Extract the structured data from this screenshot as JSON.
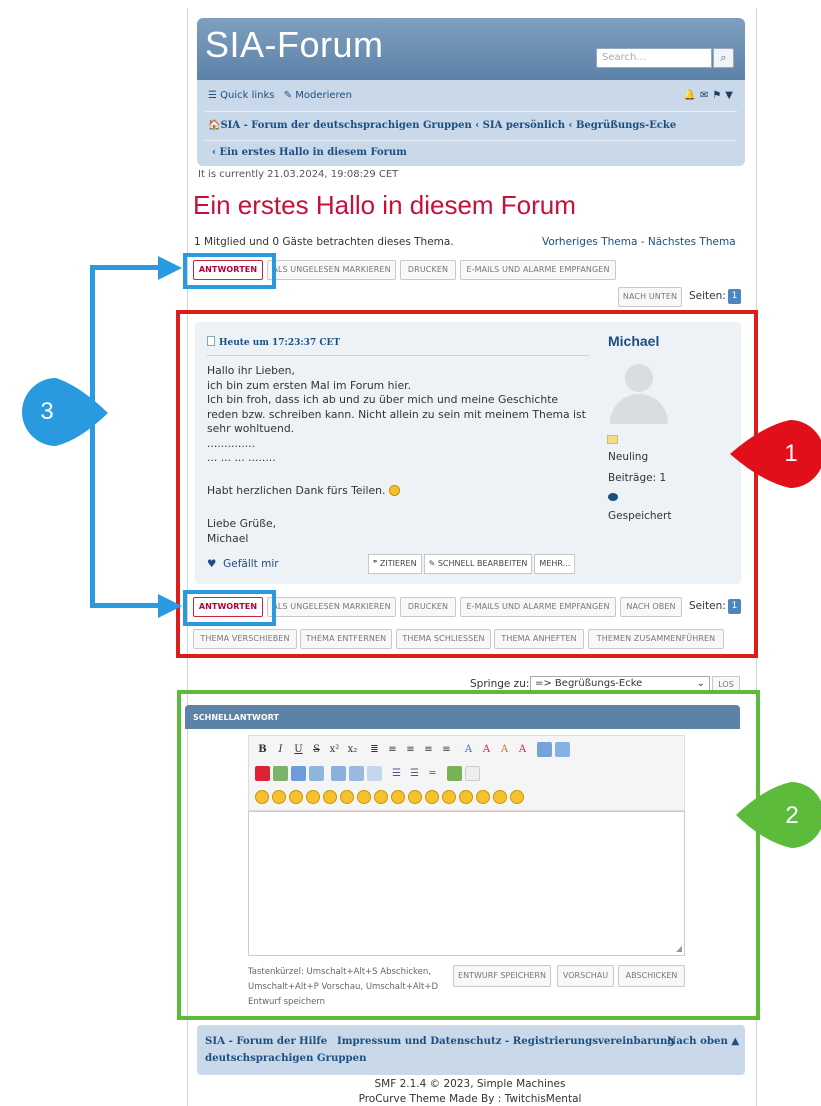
{
  "header": {
    "site_title": "SIA-Forum",
    "search_placeholder": "Search...",
    "search_icon": "magnifier-icon"
  },
  "navbar": {
    "quick_links": "☰ Quick links",
    "moderate": "✎ Moderieren",
    "icons": [
      "bell-icon",
      "envelope-icon",
      "flag-icon",
      "caret-down-icon"
    ],
    "breadcrumb": [
      "🏠SIA - Forum der deutschsprachigen Gruppen",
      "‹ SIA persönlich",
      "‹ Begrüßungs-Ecke"
    ],
    "breadcrumb2": "‹ Ein erstes Hallo in diesem Forum"
  },
  "current_time": "It is currently  21.03.2024, 19:08:29 CET",
  "topic_title": "Ein erstes Hallo in diesem Forum",
  "viewers_text": "1 Mitglied und 0 Gäste betrachten dieses Thema.",
  "prevnext_text": "Vorheriges Thema - Nächstes Thema",
  "top_buttons": [
    "ANTWORTEN",
    "ALS UNGELESEN MARKIEREN",
    "DRUCKEN",
    "E-MAILS UND ALARME EMPFANGEN"
  ],
  "nach_unten": "NACH UNTEN",
  "pages_label": "Seiten:",
  "page_number": "1",
  "post": {
    "date": "Heute um 17:23:37 CET",
    "lines": [
      "Hallo ihr Lieben,",
      "ich bin zum ersten Mal im Forum hier.",
      "Ich bin froh, dass ich ab und zu über mich und meine Geschichte",
      "reden bzw. schreiben kann. Nicht allein zu sein mit meinem Thema ist",
      "sehr wohltuend.",
      "..............",
      "... ... ... ........",
      "",
      "Habt herzlichen Dank fürs Teilen.",
      "",
      "Liebe Grüße,",
      "Michael"
    ],
    "like": "Gefällt mir",
    "actions": [
      "❞ ZITIEREN",
      "✎ SCHNELL BEARBEITEN",
      "MEHR..."
    ]
  },
  "author": {
    "name": "Michael",
    "rank": "Neuling",
    "posts": "Beiträge: 1",
    "status": "Gespeichert"
  },
  "bottom_buttons": [
    "ANTWORTEN",
    "ALS UNGELESEN MARKIEREN",
    "DRUCKEN",
    "E-MAILS UND ALARME EMPFANGEN",
    "NACH OBEN"
  ],
  "mod_buttons": [
    "THEMA VERSCHIEBEN",
    "THEMA ENTFERNEN",
    "THEMA SCHLIESSEN",
    "THEMA ANHEFTEN",
    "THEMEN ZUSAMMENFÜHREN"
  ],
  "jump": {
    "label": "Springe zu:",
    "selected": "=> Begrüßungs-Ecke",
    "button": "LOS"
  },
  "quick_reply": {
    "title": "SCHNELLANTWORT",
    "shortcut_text": "Tastenkürzel: Umschalt+Alt+S Abschicken, Umschalt+Alt+P Vorschau, Umschalt+Alt+D Entwurf speichern",
    "buttons": [
      "ENTWURF SPEICHERN",
      "VORSCHAU",
      "ABSCHICKEN"
    ]
  },
  "footer": {
    "home": "SIA - Forum der",
    "home2": "deutschsprachigen Gruppen",
    "links": [
      "Hilfe",
      "Impressum und Datenschutz - Registrierungsvereinbarung",
      "Nach oben ▲"
    ],
    "copyright": "SMF 2.1.4 © 2023, Simple Machines",
    "theme": "ProCurve Theme Made By : TwitchisMental"
  },
  "annotations": {
    "marker1": "1",
    "marker2": "2",
    "marker3": "3"
  },
  "colors": {
    "accent": "#c8103c",
    "header": "#5d82a8",
    "nav": "#c9d9e9",
    "red_box": "#dd1c1c",
    "green_box": "#5dbb3c",
    "blue_box": "#2a9ae0"
  }
}
